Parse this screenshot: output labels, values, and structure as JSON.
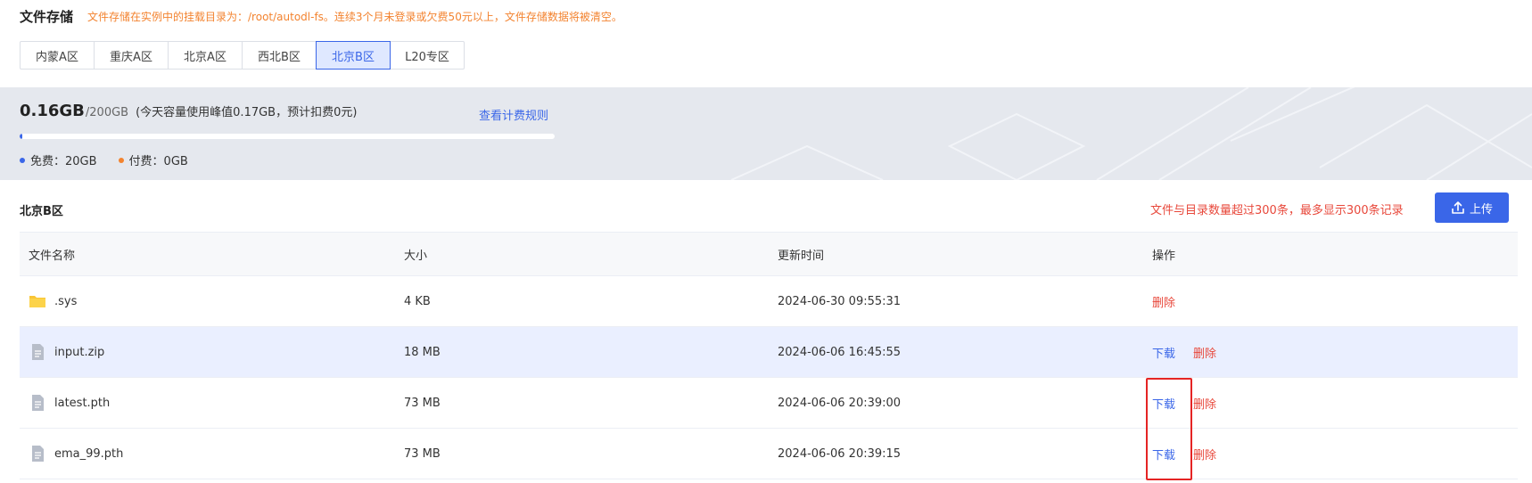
{
  "header": {
    "title": "文件存储",
    "notice": "文件存储在实例中的挂载目录为：/root/autodl-fs。连续3个月未登录或欠费50元以上，文件存储数据将被清空。"
  },
  "regions": {
    "tabs": [
      {
        "label": "内蒙A区",
        "active": false
      },
      {
        "label": "重庆A区",
        "active": false
      },
      {
        "label": "北京A区",
        "active": false
      },
      {
        "label": "西北B区",
        "active": false
      },
      {
        "label": "北京B区",
        "active": true
      },
      {
        "label": "L20专区",
        "active": false
      }
    ]
  },
  "usage": {
    "used": "0.16GB",
    "total": "/200GB",
    "peak_note": "(今天容量使用峰值0.17GB，预计扣费0元)",
    "rules_link": "查看计费规则",
    "progress_fraction": 0.0008,
    "legend": [
      {
        "label": "免费：20GB",
        "color": "#3a66e8"
      },
      {
        "label": "付费：0GB",
        "color": "#f3832f"
      }
    ]
  },
  "section": {
    "title": "北京B区",
    "limit_note": "文件与目录数量超过300条，最多显示300条记录",
    "upload_label": "上传"
  },
  "table": {
    "columns": [
      "文件名称",
      "大小",
      "更新时间",
      "操作"
    ],
    "rows": [
      {
        "name": ".sys",
        "type": "folder",
        "size": "4 KB",
        "updated": "2024-06-30 09:55:31",
        "actions": {
          "download": "",
          "delete": "删除"
        }
      },
      {
        "name": "input.zip",
        "type": "file",
        "size": "18 MB",
        "updated": "2024-06-06 16:45:55",
        "actions": {
          "download": "下载",
          "delete": "删除"
        }
      },
      {
        "name": "latest.pth",
        "type": "file",
        "size": "73 MB",
        "updated": "2024-06-06 20:39:00",
        "actions": {
          "download": "下载",
          "delete": "删除"
        }
      },
      {
        "name": "ema_99.pth",
        "type": "file",
        "size": "73 MB",
        "updated": "2024-06-06 20:39:15",
        "actions": {
          "download": "下载",
          "delete": "删除"
        }
      }
    ]
  }
}
